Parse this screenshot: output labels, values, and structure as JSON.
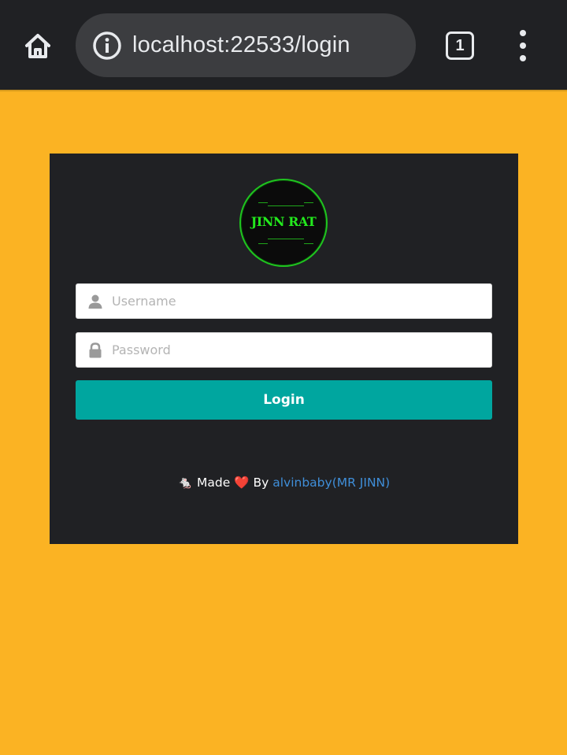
{
  "browser": {
    "url": "localhost:22533/login",
    "tab_count": "1"
  },
  "logo": {
    "text": "JINN RAT"
  },
  "form": {
    "username_placeholder": "Username",
    "password_placeholder": "Password",
    "login_label": "Login"
  },
  "footer": {
    "prefix_icon": "🐁",
    "made": "Made",
    "heart": "❤️",
    "by": "By",
    "author_link": "alvinbaby(MR JINN)"
  },
  "colors": {
    "page_bg": "#fbb323",
    "card_bg": "#202124",
    "button_bg": "#00a69f",
    "link": "#3f8ed8",
    "logo_green": "#23e81d"
  }
}
